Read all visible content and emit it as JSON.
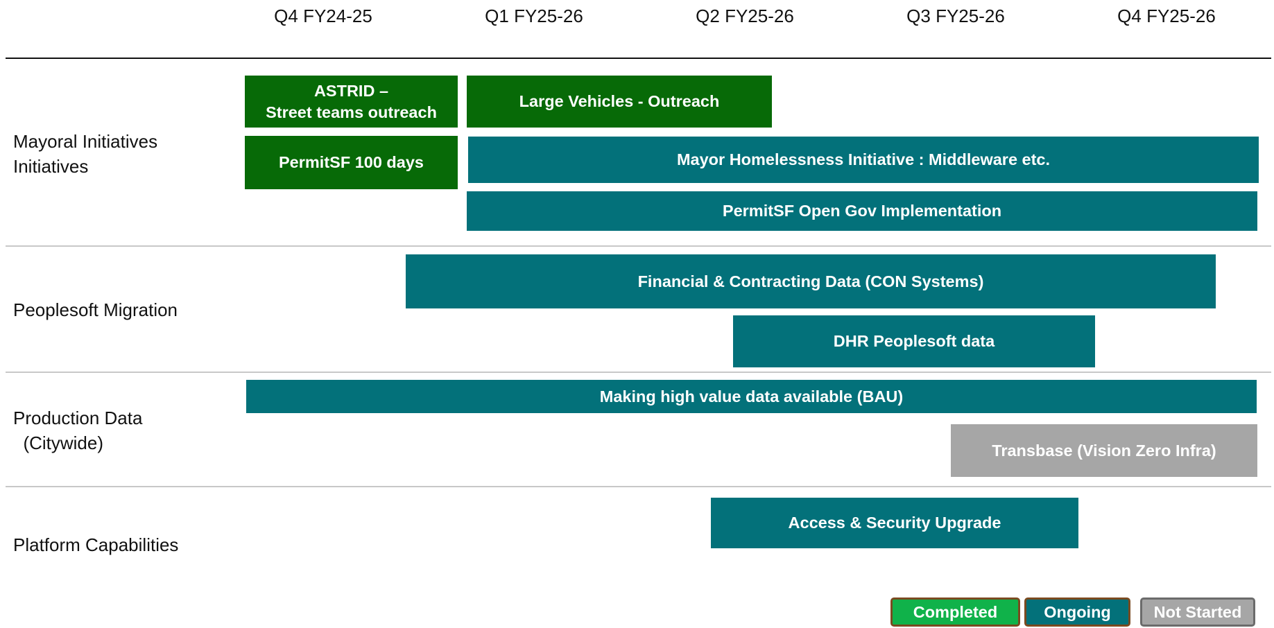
{
  "colors": {
    "completed": "#076a07",
    "ongoing": "#03717a",
    "not_started": "#a6a6a6"
  },
  "quarters": [
    "Q4 FY24-25",
    "Q1 FY25-26",
    "Q2 FY25-26",
    "Q3 FY25-26",
    "Q4 FY25-26"
  ],
  "rows": [
    {
      "lines": [
        "Mayoral Initiatives",
        "Initiatives"
      ]
    },
    {
      "lines": [
        "Peoplesoft Migration"
      ]
    },
    {
      "lines": [
        "Production Data",
        "  (Citywide)"
      ]
    },
    {
      "lines": [
        "Platform Capabilities"
      ]
    }
  ],
  "bars": {
    "astrid": {
      "lines": [
        "ASTRID –",
        "Street teams outreach"
      ],
      "status": "completed"
    },
    "large_vehicles": {
      "lines": [
        "Large Vehicles - Outreach"
      ],
      "status": "completed"
    },
    "permitsf_100": {
      "lines": [
        "PermitSF 100 days"
      ],
      "status": "completed"
    },
    "mayor_homelessness": {
      "lines": [
        "Mayor Homelessness Initiative : Middleware etc."
      ],
      "status": "ongoing"
    },
    "permitsf_open_gov": {
      "lines": [
        "PermitSF Open Gov Implementation"
      ],
      "status": "ongoing"
    },
    "financial_contracting": {
      "lines": [
        "Financial & Contracting Data (CON Systems)"
      ],
      "status": "ongoing"
    },
    "dhr_peoplesoft": {
      "lines": [
        "DHR Peoplesoft data"
      ],
      "status": "ongoing"
    },
    "high_value_data": {
      "lines": [
        "Making high value data available  (BAU)"
      ],
      "status": "ongoing"
    },
    "transbase": {
      "lines": [
        "Transbase (Vision Zero Infra)"
      ],
      "status": "not_started"
    },
    "access_security": {
      "lines": [
        "Access & Security Upgrade"
      ],
      "status": "ongoing"
    }
  },
  "legend": {
    "completed": "Completed",
    "ongoing": "Ongoing",
    "not_started": "Not Started"
  }
}
